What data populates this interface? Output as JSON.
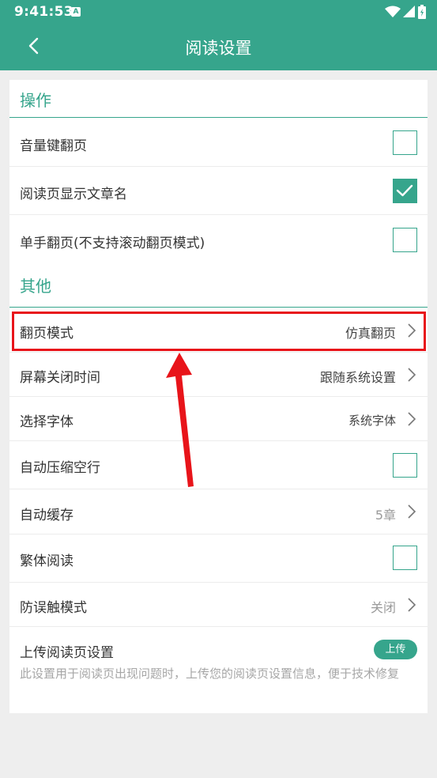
{
  "status_bar": {
    "time": "9:41:53",
    "indicator": "A",
    "icons": [
      "wifi-icon",
      "signal-icon",
      "battery-icon"
    ]
  },
  "header": {
    "title": "阅读设置",
    "back_icon": "chevron-left-icon"
  },
  "sections": [
    {
      "title": "操作",
      "items": [
        {
          "label": "音量键翻页",
          "control": "checkbox",
          "checked": false
        },
        {
          "label": "阅读页显示文章名",
          "control": "checkbox",
          "checked": true
        },
        {
          "label": "单手翻页(不支持滚动翻页模式)",
          "control": "checkbox",
          "checked": false
        }
      ]
    },
    {
      "title": "其他",
      "items": [
        {
          "label": "翻页模式",
          "control": "select",
          "value": "仿真翻页"
        },
        {
          "label": "屏幕关闭时间",
          "control": "select",
          "value": "跟随系统设置"
        },
        {
          "label": "选择字体",
          "control": "select",
          "value": "系统字体"
        },
        {
          "label": "自动压缩空行",
          "control": "checkbox",
          "checked": false
        },
        {
          "label": "自动缓存",
          "control": "select",
          "value": "5章"
        },
        {
          "label": "繁体阅读",
          "control": "checkbox",
          "checked": false
        },
        {
          "label": "防误触模式",
          "control": "select",
          "value": "关闭"
        },
        {
          "label": "上传阅读页设置",
          "control": "button",
          "button_label": "上传",
          "description": "此设置用于阅读页出现问题时，上传您的阅读页设置信息，便于技术修复"
        }
      ]
    }
  ],
  "colors": {
    "accent": "#36a58c",
    "background": "#eeeeee",
    "highlight": "#e8141a"
  }
}
